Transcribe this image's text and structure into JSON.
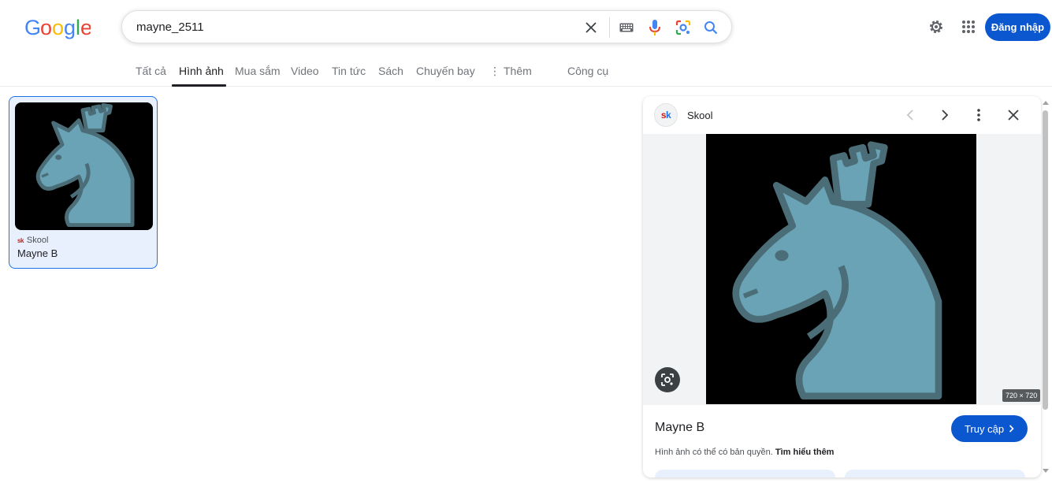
{
  "search": {
    "query": "mayne_2511"
  },
  "header": {
    "login_label": "Đăng nhập",
    "brand_colors": {
      "blue": "#4285F4",
      "red": "#EA4335",
      "yellow": "#FBBC05",
      "green": "#34A853"
    }
  },
  "tabs": [
    {
      "label": "Tất cả"
    },
    {
      "label": "Hình ảnh",
      "active": true
    },
    {
      "label": "Mua sắm"
    },
    {
      "label": "Video"
    },
    {
      "label": "Tin tức"
    },
    {
      "label": "Sách"
    },
    {
      "label": "Chuyến bay"
    },
    {
      "label": "Thêm"
    },
    {
      "label": "Công cụ"
    }
  ],
  "result": {
    "source": "Skool",
    "title": "Mayne B",
    "favicon_text": "sk"
  },
  "panel": {
    "source": "Skool",
    "favicon_text": "sk",
    "dimensions": "720 × 720",
    "title": "Mayne B",
    "visit_label": "Truy cập",
    "copyright": "Hình ảnh có thể có bản quyền.",
    "learn_more": "Tìm hiểu thêm"
  },
  "colors": {
    "accent": "#0b57d0",
    "knight_fill": "#6aa3b5",
    "knight_outline": "#4a6d77"
  }
}
